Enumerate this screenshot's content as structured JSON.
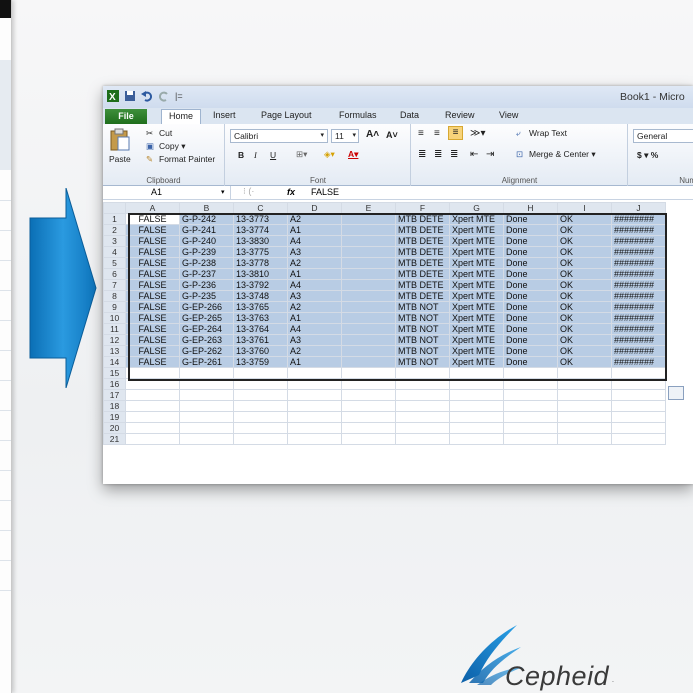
{
  "window": {
    "title": "Book1 - Micro"
  },
  "tabs": [
    "File",
    "Home",
    "Insert",
    "Page Layout",
    "Formulas",
    "Data",
    "Review",
    "View"
  ],
  "ribbon": {
    "clipboard": {
      "paste": "Paste",
      "cut": "Cut",
      "copy": "Copy ▾",
      "format_painter": "Format Painter",
      "label": "Clipboard"
    },
    "font": {
      "name": "Calibri",
      "size": "11",
      "label": "Font",
      "bold": "B",
      "italic": "I",
      "underline": "U"
    },
    "alignment": {
      "wrap_text": "Wrap Text",
      "merge_center": "Merge & Center ▾",
      "label": "Alignment"
    },
    "number": {
      "format": "General",
      "currency": "$ ▾ %",
      "label": "Numbe"
    }
  },
  "formula_bar": {
    "name_box": "A1",
    "fx": "fx",
    "value": "FALSE"
  },
  "grid": {
    "columns": [
      "A",
      "B",
      "C",
      "D",
      "E",
      "F",
      "G",
      "H",
      "I",
      "J"
    ],
    "rows": [
      [
        "FALSE",
        "G-P-242",
        "13-3773",
        "A2",
        "",
        "MTB DETE",
        "Xpert MTE",
        "Done",
        "OK",
        "########"
      ],
      [
        "FALSE",
        "G-P-241",
        "13-3774",
        "A1",
        "",
        "MTB DETE",
        "Xpert MTE",
        "Done",
        "OK",
        "########"
      ],
      [
        "FALSE",
        "G-P-240",
        "13-3830",
        "A4",
        "",
        "MTB DETE",
        "Xpert MTE",
        "Done",
        "OK",
        "########"
      ],
      [
        "FALSE",
        "G-P-239",
        "13-3775",
        "A3",
        "",
        "MTB DETE",
        "Xpert MTE",
        "Done",
        "OK",
        "########"
      ],
      [
        "FALSE",
        "G-P-238",
        "13-3778",
        "A2",
        "",
        "MTB DETE",
        "Xpert MTE",
        "Done",
        "OK",
        "########"
      ],
      [
        "FALSE",
        "G-P-237",
        "13-3810",
        "A1",
        "",
        "MTB DETE",
        "Xpert MTE",
        "Done",
        "OK",
        "########"
      ],
      [
        "FALSE",
        "G-P-236",
        "13-3792",
        "A4",
        "",
        "MTB DETE",
        "Xpert MTE",
        "Done",
        "OK",
        "########"
      ],
      [
        "FALSE",
        "G-P-235",
        "13-3748",
        "A3",
        "",
        "MTB DETE",
        "Xpert MTE",
        "Done",
        "OK",
        "########"
      ],
      [
        "FALSE",
        "G-EP-266",
        "13-3765",
        "A2",
        "",
        "MTB NOT",
        "Xpert MTE",
        "Done",
        "OK",
        "########"
      ],
      [
        "FALSE",
        "G-EP-265",
        "13-3763",
        "A1",
        "",
        "MTB NOT",
        "Xpert MTE",
        "Done",
        "OK",
        "########"
      ],
      [
        "FALSE",
        "G-EP-264",
        "13-3764",
        "A4",
        "",
        "MTB NOT",
        "Xpert MTE",
        "Done",
        "OK",
        "########"
      ],
      [
        "FALSE",
        "G-EP-263",
        "13-3761",
        "A3",
        "",
        "MTB NOT",
        "Xpert MTE",
        "Done",
        "OK",
        "########"
      ],
      [
        "FALSE",
        "G-EP-262",
        "13-3760",
        "A2",
        "",
        "MTB NOT",
        "Xpert MTE",
        "Done",
        "OK",
        "########"
      ],
      [
        "FALSE",
        "G-EP-261",
        "13-3759",
        "A1",
        "",
        "MTB NOT",
        "Xpert MTE",
        "Done",
        "OK",
        "########"
      ]
    ],
    "total_rows": 21
  },
  "logo": {
    "text": "Cepheid",
    "mark": "."
  },
  "colors": {
    "arrow": "#1a84cc",
    "selection": "#b8cce4",
    "file_tab": "#2e7d2b"
  }
}
